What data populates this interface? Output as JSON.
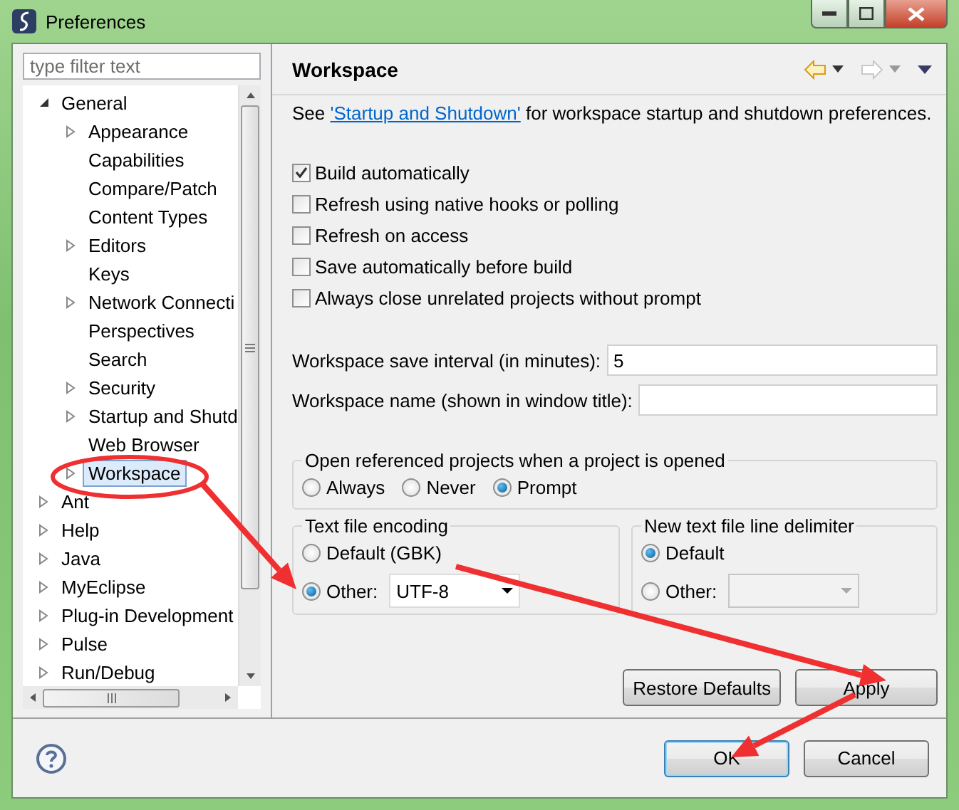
{
  "window": {
    "title": "Preferences"
  },
  "filter": {
    "placeholder": "type filter text"
  },
  "tree": [
    {
      "label": "General",
      "kind": "folder",
      "expanded": true,
      "selected": false,
      "children": [
        {
          "label": "Appearance",
          "kind": "folder",
          "expanded": false,
          "selected": false
        },
        {
          "label": "Capabilities",
          "kind": "leaf",
          "selected": false
        },
        {
          "label": "Compare/Patch",
          "kind": "leaf",
          "selected": false
        },
        {
          "label": "Content Types",
          "kind": "leaf",
          "selected": false
        },
        {
          "label": "Editors",
          "kind": "folder",
          "expanded": false,
          "selected": false
        },
        {
          "label": "Keys",
          "kind": "leaf",
          "selected": false
        },
        {
          "label": "Network Connecti",
          "kind": "folder",
          "expanded": false,
          "selected": false
        },
        {
          "label": "Perspectives",
          "kind": "leaf",
          "selected": false
        },
        {
          "label": "Search",
          "kind": "leaf",
          "selected": false
        },
        {
          "label": "Security",
          "kind": "folder",
          "expanded": false,
          "selected": false
        },
        {
          "label": "Startup and Shutd",
          "kind": "folder",
          "expanded": false,
          "selected": false
        },
        {
          "label": "Web Browser",
          "kind": "leaf",
          "selected": false
        },
        {
          "label": "Workspace",
          "kind": "folder",
          "expanded": false,
          "selected": true
        }
      ]
    },
    {
      "label": "Ant",
      "kind": "folder",
      "expanded": false,
      "selected": false
    },
    {
      "label": "Help",
      "kind": "folder",
      "expanded": false,
      "selected": false
    },
    {
      "label": "Java",
      "kind": "folder",
      "expanded": false,
      "selected": false
    },
    {
      "label": "MyEclipse",
      "kind": "folder",
      "expanded": false,
      "selected": false
    },
    {
      "label": "Plug-in Development",
      "kind": "folder",
      "expanded": false,
      "selected": false
    },
    {
      "label": "Pulse",
      "kind": "folder",
      "expanded": false,
      "selected": false
    },
    {
      "label": "Run/Debug",
      "kind": "folder",
      "expanded": false,
      "selected": false
    }
  ],
  "page": {
    "title": "Workspace",
    "back_enabled": true,
    "forward_enabled": false,
    "intro": {
      "before": "See ",
      "link": "'Startup and Shutdown'",
      "after": " for workspace startup and shutdown preferences."
    },
    "checkboxes": [
      {
        "label": "Build automatically",
        "checked": true
      },
      {
        "label": "Refresh using native hooks or polling",
        "checked": false
      },
      {
        "label": "Refresh on access",
        "checked": false
      },
      {
        "label": "Save automatically before build",
        "checked": false
      },
      {
        "label": "Always close unrelated projects without prompt",
        "checked": false
      }
    ],
    "fields": [
      {
        "label": "Workspace save interval (in minutes):",
        "value": "5"
      },
      {
        "label": "Workspace name (shown in window title):"
      }
    ],
    "open_referenced": {
      "title": "Open referenced projects when a project is opened",
      "options": [
        {
          "label": "Always",
          "selected": false
        },
        {
          "label": "Never",
          "selected": false
        },
        {
          "label": "Prompt",
          "selected": true
        }
      ]
    },
    "encoding": {
      "title": "Text file encoding",
      "options": [
        {
          "label": "Default (GBK)",
          "selected": false
        },
        {
          "label": "Other:",
          "selected": true
        }
      ],
      "other_value": "UTF-8",
      "other_enabled": true
    },
    "delimiter": {
      "title": "New text file line delimiter",
      "options": [
        {
          "label": "Default",
          "selected": true
        },
        {
          "label": "Other:",
          "selected": false
        }
      ],
      "other_enabled": false
    },
    "buttons": [
      "Restore Defaults",
      "Apply"
    ]
  },
  "dialog_buttons": [
    {
      "label": "OK",
      "default": true
    },
    {
      "label": "Cancel",
      "default": false
    }
  ]
}
